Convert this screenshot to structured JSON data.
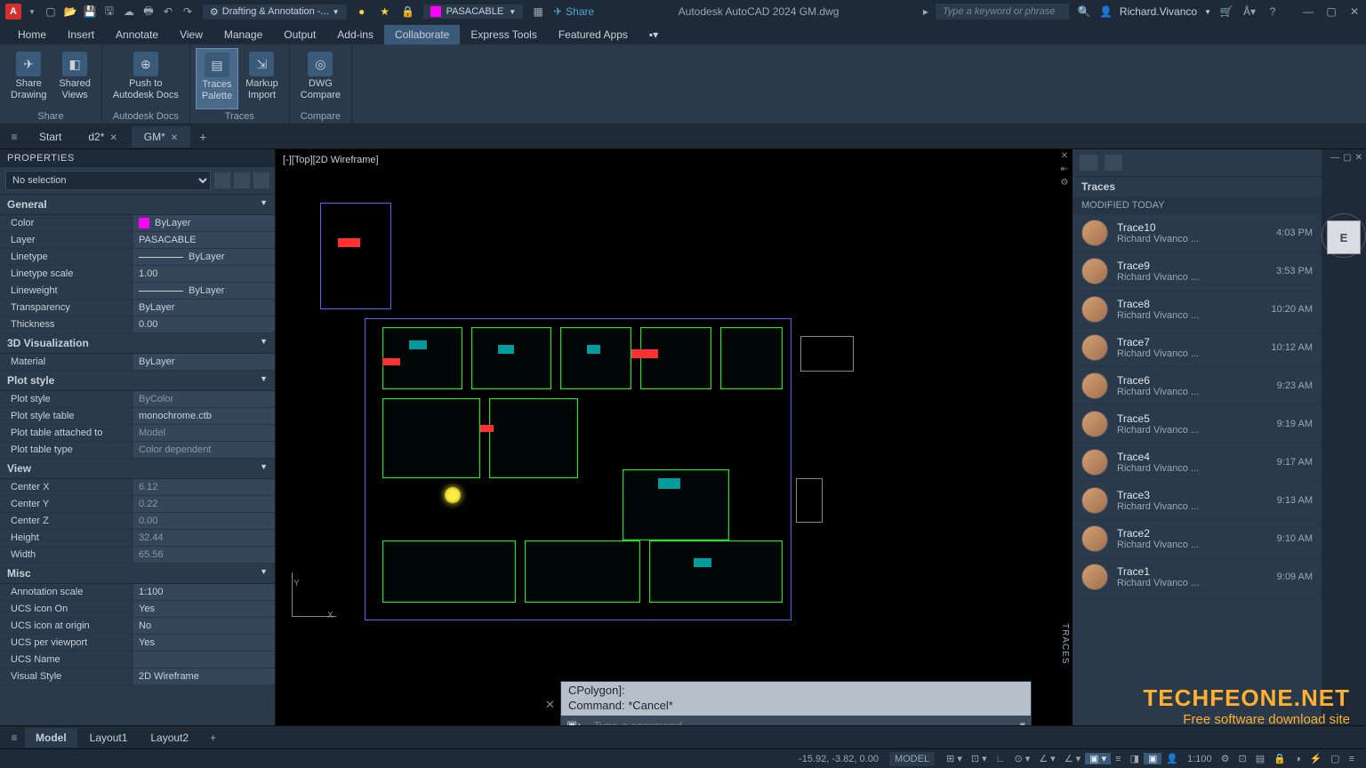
{
  "app": {
    "logo_letter": "A",
    "workspace": "Drafting & Annotation -...",
    "layer_pill": "PASACABLE",
    "share_label": "Share",
    "title_center": "Autodesk AutoCAD 2024   GM.dwg",
    "search_placeholder": "Type a keyword or phrase",
    "user": "Richard.Vivanco"
  },
  "ribbon_tabs": [
    "Home",
    "Insert",
    "Annotate",
    "View",
    "Manage",
    "Output",
    "Add-ins",
    "Collaborate",
    "Express Tools",
    "Featured Apps"
  ],
  "active_ribbon_tab": "Collaborate",
  "ribbon": {
    "share": {
      "btn1": "Share\nDrawing",
      "btn2": "Shared\nViews",
      "label": "Share"
    },
    "docs": {
      "btn1": "Push to\nAutodesk Docs",
      "label": "Autodesk Docs"
    },
    "traces": {
      "btn1": "Traces\nPalette",
      "btn2": "Markup\nImport",
      "label": "Traces"
    },
    "compare": {
      "btn1": "DWG\nCompare",
      "label": "Compare"
    }
  },
  "doc_tabs": [
    {
      "label": "Start",
      "active": false,
      "closeable": false
    },
    {
      "label": "d2*",
      "active": false,
      "closeable": true
    },
    {
      "label": "GM*",
      "active": true,
      "closeable": true
    }
  ],
  "properties": {
    "title": "PROPERTIES",
    "selection": "No selection",
    "categories": [
      {
        "name": "General",
        "rows": [
          {
            "k": "Color",
            "v": "ByLayer",
            "swatch": "#ff00ff"
          },
          {
            "k": "Layer",
            "v": "PASACABLE"
          },
          {
            "k": "Linetype",
            "v": "ByLayer",
            "line": true
          },
          {
            "k": "Linetype scale",
            "v": "1.00"
          },
          {
            "k": "Lineweight",
            "v": "ByLayer",
            "line": true
          },
          {
            "k": "Transparency",
            "v": "ByLayer"
          },
          {
            "k": "Thickness",
            "v": "0.00"
          }
        ]
      },
      {
        "name": "3D Visualization",
        "rows": [
          {
            "k": "Material",
            "v": "ByLayer"
          }
        ]
      },
      {
        "name": "Plot style",
        "rows": [
          {
            "k": "Plot style",
            "v": "ByColor",
            "dim": true
          },
          {
            "k": "Plot style table",
            "v": "monochrome.ctb"
          },
          {
            "k": "Plot table attached to",
            "v": "Model",
            "dim": true
          },
          {
            "k": "Plot table type",
            "v": "Color dependent",
            "dim": true
          }
        ]
      },
      {
        "name": "View",
        "rows": [
          {
            "k": "Center X",
            "v": "6.12",
            "dim": true
          },
          {
            "k": "Center Y",
            "v": "0.22",
            "dim": true
          },
          {
            "k": "Center Z",
            "v": "0.00",
            "dim": true
          },
          {
            "k": "Height",
            "v": "32.44",
            "dim": true
          },
          {
            "k": "Width",
            "v": "65.56",
            "dim": true
          }
        ]
      },
      {
        "name": "Misc",
        "rows": [
          {
            "k": "Annotation scale",
            "v": "1:100"
          },
          {
            "k": "UCS icon On",
            "v": "Yes"
          },
          {
            "k": "UCS icon at origin",
            "v": "No"
          },
          {
            "k": "UCS per viewport",
            "v": "Yes"
          },
          {
            "k": "UCS Name",
            "v": ""
          },
          {
            "k": "Visual Style",
            "v": "2D Wireframe"
          }
        ]
      }
    ]
  },
  "viewport_label": "[-][Top][2D Wireframe]",
  "viewcube_face": "E",
  "ucs": {
    "x": "X",
    "y": "Y"
  },
  "command": {
    "hist1": "CPolygon]:",
    "hist2": "Command: *Cancel*",
    "placeholder": "Type a command"
  },
  "traces": {
    "title": "Traces",
    "subtitle": "MODIFIED TODAY",
    "items": [
      {
        "name": "Trace10",
        "author": "Richard Vivanco ...",
        "time": "4:03 PM"
      },
      {
        "name": "Trace9",
        "author": "Richard Vivanco ...",
        "time": "3:53 PM"
      },
      {
        "name": "Trace8",
        "author": "Richard Vivanco ...",
        "time": "10:20 AM"
      },
      {
        "name": "Trace7",
        "author": "Richard Vivanco ...",
        "time": "10:12 AM"
      },
      {
        "name": "Trace6",
        "author": "Richard Vivanco ...",
        "time": "9:23 AM"
      },
      {
        "name": "Trace5",
        "author": "Richard Vivanco ...",
        "time": "9:19 AM"
      },
      {
        "name": "Trace4",
        "author": "Richard Vivanco ...",
        "time": "9:17 AM"
      },
      {
        "name": "Trace3",
        "author": "Richard Vivanco ...",
        "time": "9:13 AM"
      },
      {
        "name": "Trace2",
        "author": "Richard Vivanco ...",
        "time": "9:10 AM"
      },
      {
        "name": "Trace1",
        "author": "Richard Vivanco ...",
        "time": "9:09 AM"
      }
    ],
    "vert_label": "TRACES"
  },
  "layout_tabs": [
    "Model",
    "Layout1",
    "Layout2"
  ],
  "active_layout": "Model",
  "status": {
    "coords": "-15.92, -3.82, 0.00",
    "mode": "MODEL",
    "scale": "1:100"
  },
  "watermark": {
    "l1": "TECHFEONE.NET",
    "l2": "Free software download site"
  }
}
